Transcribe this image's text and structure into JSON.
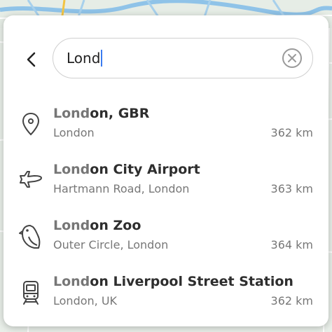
{
  "search": {
    "query": "Lond"
  },
  "colors": {
    "accent": "#3b7cf0",
    "text": "#2e2e2e",
    "muted": "#777777"
  },
  "results": [
    {
      "icon": "location-pin-icon",
      "match": "Lond",
      "rest": "on, GBR",
      "subtitle": "London",
      "distance": "362 km"
    },
    {
      "icon": "airplane-icon",
      "match": "Lond",
      "rest": "on City Airport",
      "subtitle": "Hartmann Road, London",
      "distance": "363 km"
    },
    {
      "icon": "bird-icon",
      "match": "Lond",
      "rest": "on Zoo",
      "subtitle": "Outer Circle, London",
      "distance": "364 km"
    },
    {
      "icon": "train-icon",
      "match": "Lond",
      "rest": "on Liverpool Street Station",
      "subtitle": "London, UK",
      "distance": "362 km"
    }
  ]
}
